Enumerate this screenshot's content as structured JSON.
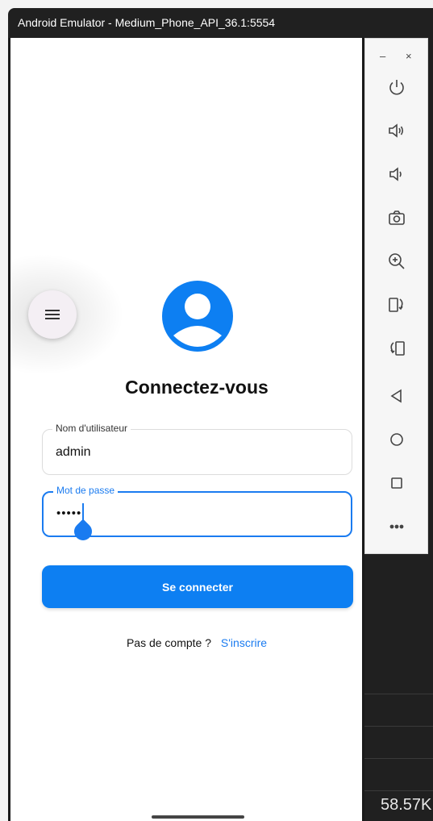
{
  "window": {
    "title": "Android Emulator - Medium_Phone_API_36.1:5554"
  },
  "app": {
    "title": "Connectez-vous",
    "username": {
      "label": "Nom d'utilisateur",
      "value": "admin"
    },
    "password": {
      "label": "Mot de passe",
      "value": "•••••"
    },
    "login_button": "Se connecter",
    "signup_prompt": "Pas de compte ?",
    "signup_link": "S'inscrire"
  },
  "toolbar": {
    "minimize": "–",
    "close": "×",
    "items": [
      "power-icon",
      "volume-up-icon",
      "volume-down-icon",
      "camera-icon",
      "zoom-icon",
      "rotate-left-icon",
      "rotate-right-icon",
      "back-icon",
      "home-icon",
      "overview-icon",
      "more-icon"
    ]
  },
  "desktop": {
    "bottom_text": "58.57K"
  },
  "colors": {
    "accent": "#0d7ff2",
    "title_bar": "#202020"
  }
}
